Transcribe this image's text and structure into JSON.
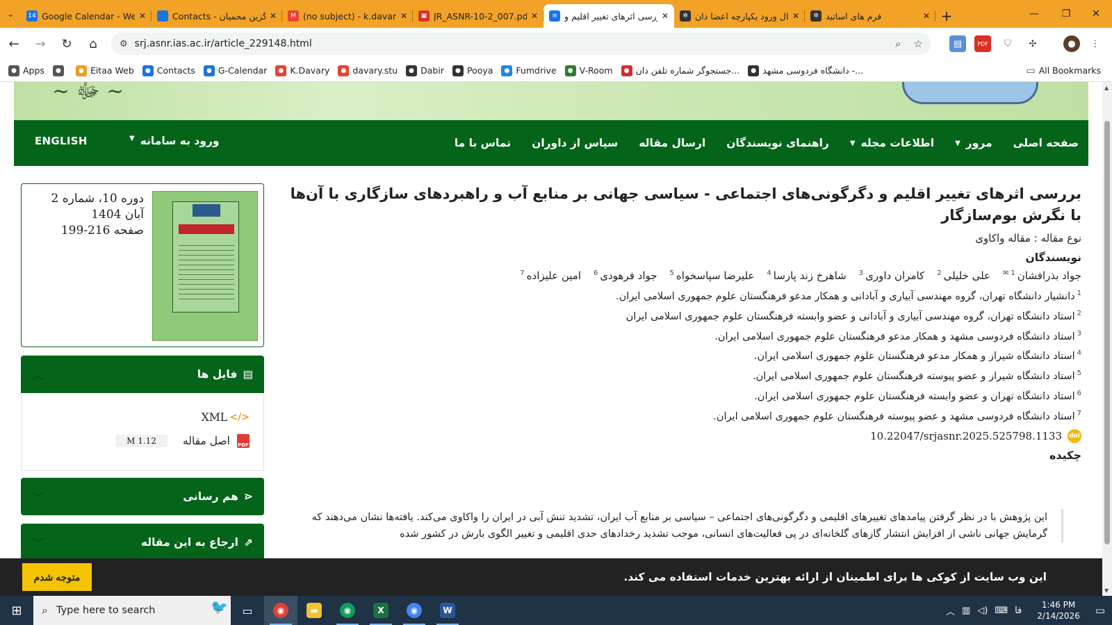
{
  "browser": {
    "tabs": [
      {
        "title": "Google Calendar - Wee",
        "icon": "14",
        "icon_color": "#1a73e8"
      },
      {
        "title": "Contacts - گزین محمیان",
        "icon": "👤",
        "icon_color": "#1a73e8"
      },
      {
        "title": "(no subject) - k.davary@",
        "icon": "M",
        "icon_color": "#ea4335"
      },
      {
        "title": "JR_ASNR-10-2_007.pdf",
        "icon": "▣",
        "icon_color": "#d93025"
      },
      {
        "title": "بررسی اثرهای تغییر اقلیم و",
        "icon": "≡",
        "icon_color": "#1a73e8"
      },
      {
        "title": "پرتال ورود یکپارچه اعضا دان",
        "icon": "✲",
        "icon_color": "#333"
      },
      {
        "title": "فرم های اساتید",
        "icon": "✲",
        "icon_color": "#333"
      }
    ],
    "active_tab": 4,
    "url": "srj.asnr.ias.ac.ir/article_229148.html",
    "bookmarks": [
      {
        "label": "Apps",
        "icon_color": "#555"
      },
      {
        "label": "",
        "icon_color": "#555"
      },
      {
        "label": "Eitaa Web",
        "icon_color": "#f29d1e"
      },
      {
        "label": "Contacts",
        "icon_color": "#1a73e8"
      },
      {
        "label": "G-Calendar",
        "icon_color": "#1a73e8"
      },
      {
        "label": "K.Davary",
        "icon_color": "#ea4335"
      },
      {
        "label": "davary.stu",
        "icon_color": "#ea4335"
      },
      {
        "label": "Dabir",
        "icon_color": "#333"
      },
      {
        "label": "Pooya",
        "icon_color": "#333"
      },
      {
        "label": "Fumdrive",
        "icon_color": "#1e88e5"
      },
      {
        "label": "V-Room",
        "icon_color": "#2e7d32"
      },
      {
        "label": "جستجوگر شماره تلفن دان...",
        "icon_color": "#d32f2f"
      },
      {
        "label": "دانشگاه فردوسی مشهد -...",
        "icon_color": "#333"
      }
    ],
    "all_bookmarks": "All Bookmarks"
  },
  "site": {
    "nav": [
      "صفحه اصلی",
      "مرور",
      "اطلاعات مجله",
      "راهنمای نویسندگان",
      "ارسال مقاله",
      "سپاس از داوران",
      "تماس با ما"
    ],
    "login": "ورود به سامانه",
    "english": "ENGLISH"
  },
  "article": {
    "title": "بررسی اثرهای تغییر اقلیم و دگرگونی‌های اجتماعی - سیاسی جهانی بر منابع آب و راهبردهای سازگاری با آن‌ها با نگرش بوم‌سازگار",
    "type_line": "نوع مقاله : مقاله واکاوی",
    "authors_heading": "نویسندگان",
    "authors": [
      {
        "name": "جواد بذرافشان",
        "sup": "1"
      },
      {
        "name": "علی خلیلی",
        "sup": "2"
      },
      {
        "name": "کامران داوری",
        "sup": "3"
      },
      {
        "name": "شاهرخ زند پارسا",
        "sup": "4"
      },
      {
        "name": "علیرضا سپاسخواه",
        "sup": "5"
      },
      {
        "name": "جواد فرهودی",
        "sup": "6"
      },
      {
        "name": "امین علیزاده",
        "sup": "7"
      }
    ],
    "affiliations": [
      {
        "sup": "1",
        "text": "دانشیار دانشگاه تهران، گروه مهندسی آبیاری و آبادانی و همکار مدعو فرهنگستان علوم جمهوری اسلامی ایران."
      },
      {
        "sup": "2",
        "text": "استاد دانشگاه تهران، گروه مهندسی آبیاری و آبادانی و عضو وابسته فرهنگستان علوم جمهوری اسلامی ایران"
      },
      {
        "sup": "3",
        "text": "استاد دانشگاه فردوسی مشهد و همکار مدعو فرهنگستان علوم جمهوری اسلامی ایران."
      },
      {
        "sup": "4",
        "text": "استاد دانشگاه شیراز و همکار مدعو فرهنگستان علوم جمهوری اسلامی ایران."
      },
      {
        "sup": "5",
        "text": "استاد دانشگاه شیراز و عضو پیوسته فرهنگستان علوم جمهوری اسلامی ایران."
      },
      {
        "sup": "6",
        "text": "استاد دانشگاه تهران و عضو وابسته فرهنگستان علوم جمهوری اسلامی ایران."
      },
      {
        "sup": "7",
        "text": "استاد دانشگاه فردوسی مشهد و عضو پیوسته فرهنگستان علوم جمهوری اسلامی ایران."
      }
    ],
    "doi": "10.22047/srjasnr.2025.525798.1133",
    "abstract_heading": "چکیده",
    "abstract_text": "این پژوهش با در نظر گرفتن پیامدهای تغییرهای اقلیمی و دگرگونی‌های اجتماعی – سیاسی بر منابع آب ایران، تشدید تنش آبی در ایران را واکاوی می‌کند. یافته‌ها نشان می‌دهند که گرمایش جهانی ناشی از افزایش انتشار گازهای گلخانه‌ای در پی فعالیت‌های انسانی، موجب تشدید رخدادهای حدی اقلیمی و تغییر الگوی بارش در کشور شده"
  },
  "sidebar": {
    "issue_volume": "دوره 10، شماره 2",
    "issue_date": "آبان 1404",
    "issue_pages": "صفحه 216-199",
    "files_title": "فایل ها",
    "files": [
      {
        "label": "XML",
        "size": ""
      },
      {
        "label": "اصل مقاله",
        "size": "1.12 M"
      }
    ],
    "share_title": "هم رسانی",
    "cite_title": "ارجاع به این مقاله"
  },
  "cookie": {
    "text": "این وب سایت از کوکی ها برای اطمینان از ارائه بهترین خدمات استفاده می کند.",
    "button": "متوجه شدم"
  },
  "taskbar": {
    "search_placeholder": "Type here to search",
    "lang": "فا",
    "time": "1:46 PM",
    "date": "2/14/2026"
  }
}
